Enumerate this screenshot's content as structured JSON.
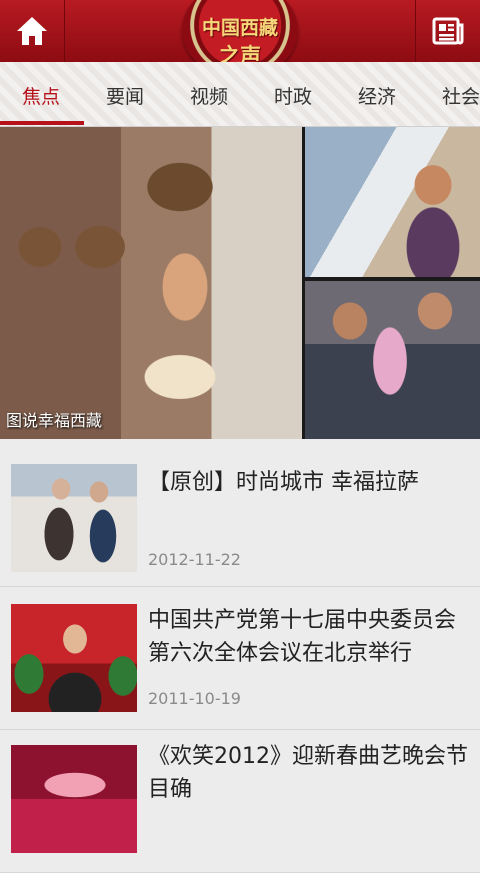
{
  "header": {
    "logo_line1": "中国西藏",
    "logo_line2": "之声",
    "home_icon": "home-icon",
    "news_icon": "newspaper-icon",
    "brand_color": "#b5121b"
  },
  "tabs": [
    {
      "label": "焦点",
      "active": true
    },
    {
      "label": "要闻"
    },
    {
      "label": "视频"
    },
    {
      "label": "时政"
    },
    {
      "label": "经济"
    },
    {
      "label": "社会"
    }
  ],
  "hero": {
    "caption": "图说幸福西藏"
  },
  "news": [
    {
      "title": "【原创】时尚城市 幸福拉萨",
      "date": "2012-11-22"
    },
    {
      "title": "中国共产党第十七届中央委员会第六次全体会议在北京举行",
      "date": "2011-10-19"
    },
    {
      "title": "《欢笑2012》迎新春曲艺晚会节目确",
      "date": ""
    }
  ]
}
